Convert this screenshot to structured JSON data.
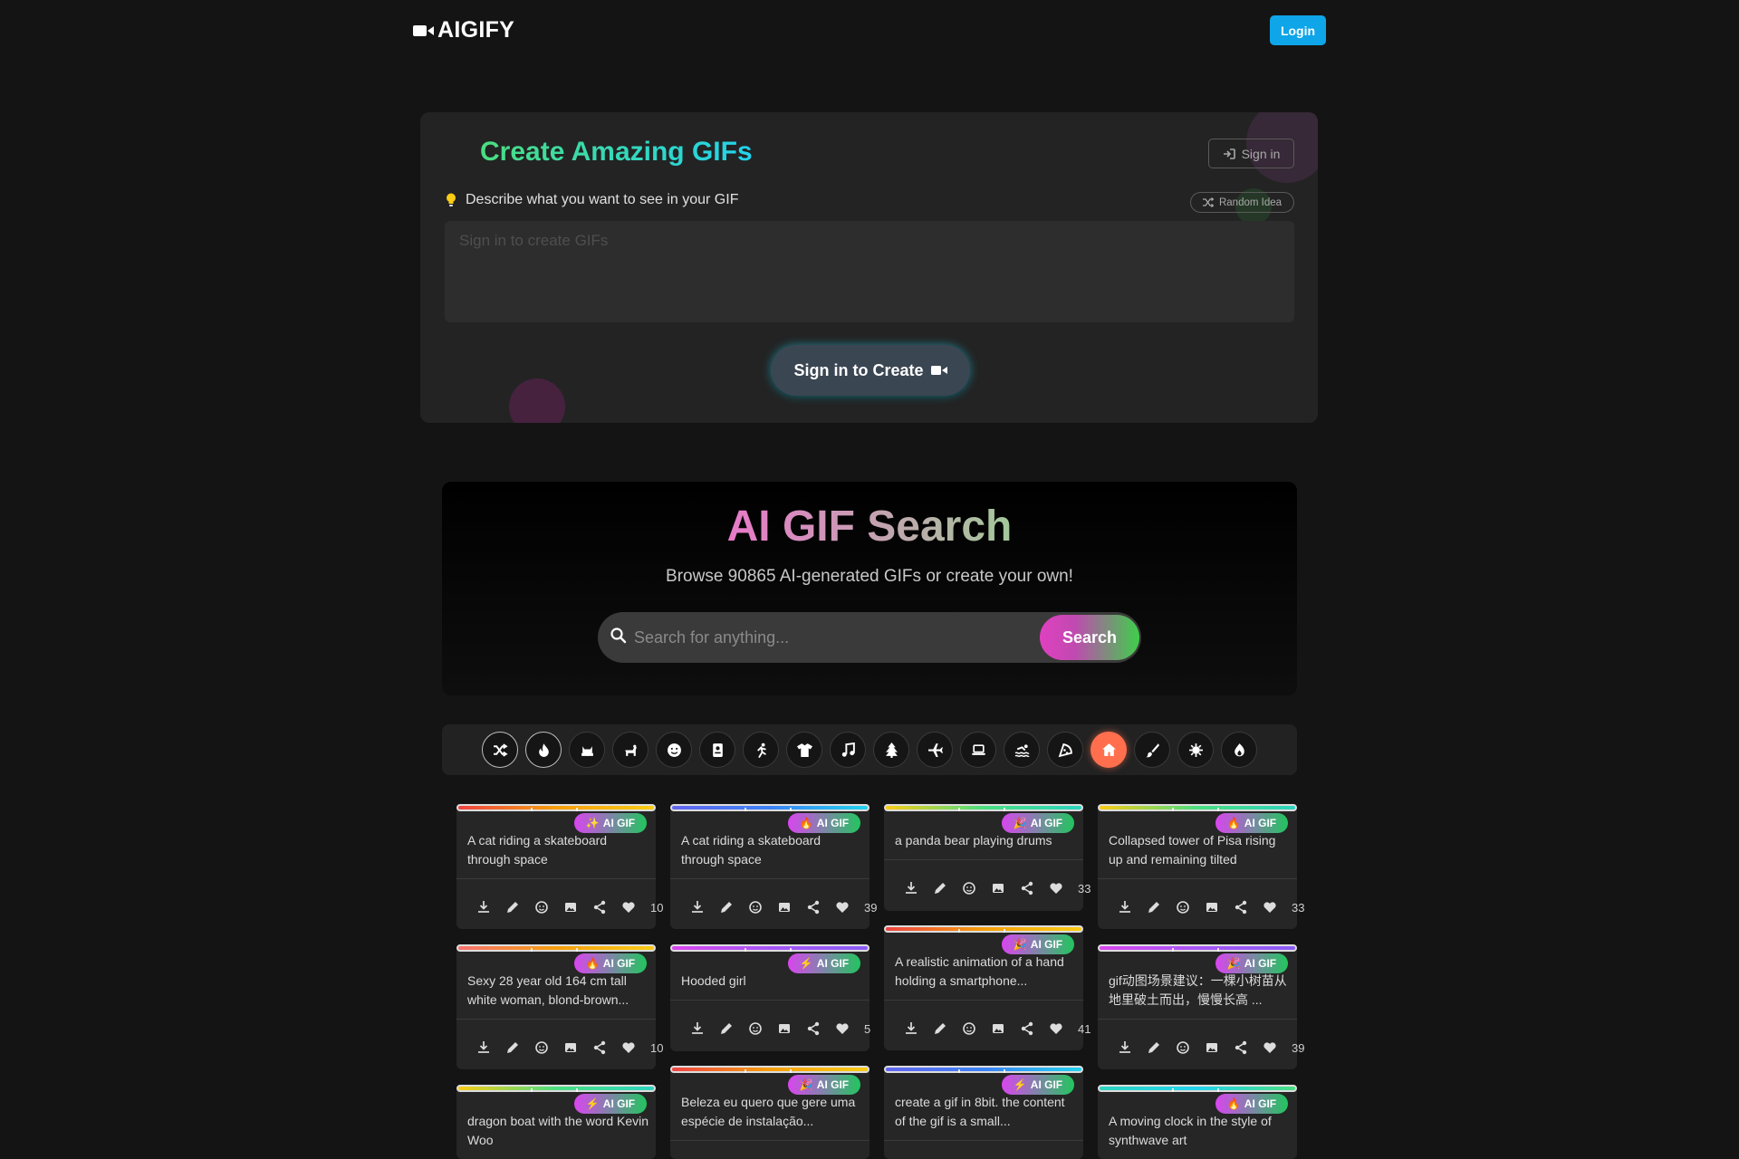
{
  "header": {
    "brand": "AIGIFY",
    "login_label": "Login"
  },
  "create": {
    "title": "Create Amazing GIFs",
    "signin_label": "Sign in",
    "describe_label": "Describe what you want to see in your GIF",
    "random_label": "Random Idea",
    "prompt_placeholder": "Sign in to create GIFs",
    "create_button_label": "Sign in to Create"
  },
  "search": {
    "title": "AI GIF Search",
    "subtitle": "Browse 90865 AI-generated GIFs or create your own!",
    "placeholder": "Search for anything...",
    "button_label": "Search"
  },
  "categories": [
    {
      "icon": "shuffle-icon",
      "state": "selected"
    },
    {
      "icon": "fire-icon",
      "state": "selected"
    },
    {
      "icon": "cat-icon"
    },
    {
      "icon": "dog-icon"
    },
    {
      "icon": "smile-icon"
    },
    {
      "icon": "id-card-icon"
    },
    {
      "icon": "running-icon"
    },
    {
      "icon": "shirt-icon"
    },
    {
      "icon": "music-icon"
    },
    {
      "icon": "tree-icon"
    },
    {
      "icon": "plane-icon"
    },
    {
      "icon": "laptop-icon"
    },
    {
      "icon": "swimmer-icon"
    },
    {
      "icon": "pizza-icon"
    },
    {
      "icon": "home-icon",
      "state": "active"
    },
    {
      "icon": "brush-icon"
    },
    {
      "icon": "virus-icon"
    },
    {
      "icon": "flame-icon"
    }
  ],
  "gifs": [
    {
      "title": "A cat riding a skateboard through space",
      "badge_emoji": "✨",
      "badge_label": "AI GIF",
      "likes": "10"
    },
    {
      "title": "A cat riding a skateboard through space",
      "badge_emoji": "🔥",
      "badge_label": "AI GIF",
      "likes": "39"
    },
    {
      "title": "a panda bear playing drums",
      "badge_emoji": "🎉",
      "badge_label": "AI GIF",
      "likes": "33"
    },
    {
      "title": "Collapsed tower of Pisa rising up and remaining tilted",
      "badge_emoji": "🔥",
      "badge_label": "AI GIF",
      "likes": "33"
    },
    {
      "title": "Sexy 28 year old 164 cm tall white woman, blond-brown...",
      "badge_emoji": "🔥",
      "badge_label": "AI GIF",
      "likes": "10"
    },
    {
      "title": "Hooded girl",
      "badge_emoji": "⚡",
      "badge_label": "AI GIF",
      "likes": "5"
    },
    {
      "title": "A realistic animation of a hand holding a smartphone...",
      "badge_emoji": "🎉",
      "badge_label": "AI GIF",
      "likes": "41"
    },
    {
      "title": "gif动图场景建议：一棵小树苗从地里破土而出，慢慢长高 ...",
      "badge_emoji": "🎉",
      "badge_label": "AI GIF",
      "likes": "39"
    },
    {
      "title": "dragon boat with the word Kevin Woo",
      "badge_emoji": "⚡",
      "badge_label": "AI GIF",
      "likes": ""
    },
    {
      "title": "Beleza eu quero que gere uma espécie de instalação...",
      "badge_emoji": "🎉",
      "badge_label": "AI GIF",
      "likes": ""
    },
    {
      "title": "create a gif in 8bit. the content of the gif is a small...",
      "badge_emoji": "⚡",
      "badge_label": "AI GIF",
      "likes": ""
    },
    {
      "title": "A moving clock in the style of synthwave art",
      "badge_emoji": "🔥",
      "badge_label": "AI GIF",
      "likes": ""
    }
  ],
  "colors": {
    "login": "#0ea5e9",
    "active_category": "#ff6f4e",
    "badge_start": "#d946ef",
    "badge_end": "#22c55e"
  }
}
